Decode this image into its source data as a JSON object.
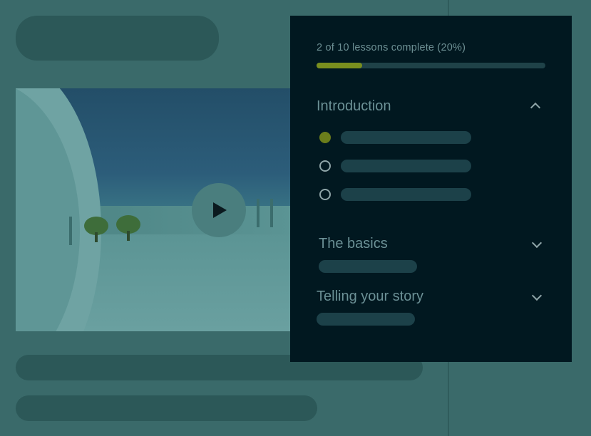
{
  "colors": {
    "page_bg": "#3a6a6a",
    "panel_bg": "#011820",
    "progress_fill": "#7a8f1e",
    "complete_dot": "#6b7d1b"
  },
  "course": {
    "progress_label": "2 of 10 lessons complete (20%)",
    "progress_fraction": 0.2,
    "sections": [
      {
        "title": "Introduction",
        "chevron": "chevron-up-icon"
      },
      {
        "title": "The basics",
        "chevron": "chevron-down-icon"
      },
      {
        "title": "Telling your story",
        "chevron": "chevron-down-icon"
      }
    ],
    "lessons": [
      {
        "state": "complete"
      },
      {
        "state": "incomplete"
      },
      {
        "state": "incomplete"
      }
    ]
  },
  "video": {
    "play_icon": "play-icon"
  }
}
